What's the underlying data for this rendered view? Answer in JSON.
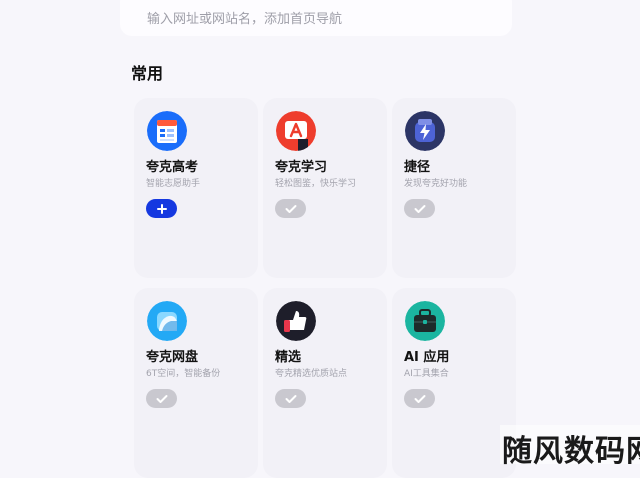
{
  "nav_input": {
    "placeholder": "输入网址或网站名，添加首页导航"
  },
  "section": {
    "title": "常用"
  },
  "apps": [
    {
      "name": "夸克高考",
      "subtitle": "智能志愿助手",
      "icon": "exam-calendar-icon",
      "action": "add",
      "accent": "#1a6dfa"
    },
    {
      "name": "夸克学习",
      "subtitle": "轻松图鉴，快乐学习",
      "icon": "study-a-icon",
      "action": "added",
      "accent": "#ee3d2d"
    },
    {
      "name": "捷径",
      "subtitle": "发现夸克好功能",
      "icon": "lightning-shortcut-icon",
      "action": "added",
      "accent": "#3f4f9a"
    },
    {
      "name": "夸克网盘",
      "subtitle": "6T空间，智能备份",
      "icon": "cloud-drive-icon",
      "action": "added",
      "accent": "#23a9f5"
    },
    {
      "name": "精选",
      "subtitle": "夸克精选优质站点",
      "icon": "thumbs-up-icon",
      "action": "added",
      "accent": "#e8364b"
    },
    {
      "name": "AI 应用",
      "subtitle": "AI工具集合",
      "icon": "briefcase-icon",
      "action": "added",
      "accent": "#1bb5a0"
    }
  ],
  "watermark": {
    "text": "随风数码网"
  },
  "colors": {
    "primary_button": "#1538e0",
    "added_button": "#c9c8cf",
    "card_bg": "#f2f1f7"
  }
}
